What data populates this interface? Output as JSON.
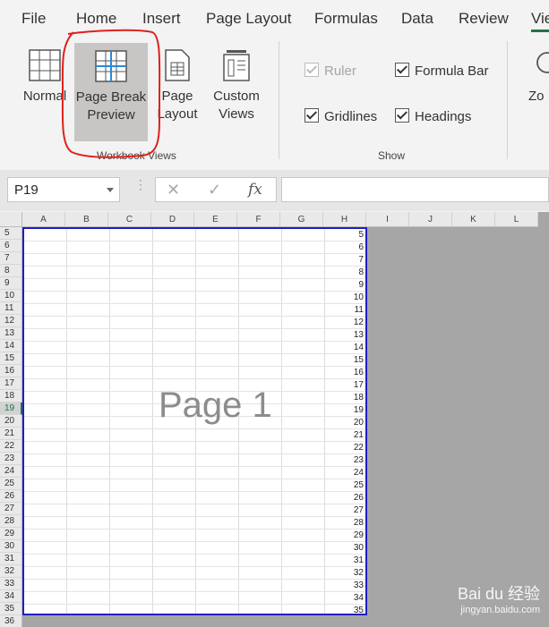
{
  "tabs": [
    "File",
    "Home",
    "Insert",
    "Page Layout",
    "Formulas",
    "Data",
    "Review",
    "Vie"
  ],
  "workbook_views": {
    "group_label": "Workbook Views",
    "buttons": [
      {
        "label_line1": "Normal",
        "label_line2": ""
      },
      {
        "label_line1": "Page Break",
        "label_line2": "Preview"
      },
      {
        "label_line1": "Page",
        "label_line2": "Layout"
      },
      {
        "label_line1": "Custom",
        "label_line2": "Views"
      }
    ]
  },
  "show": {
    "group_label": "Show",
    "ruler": "Ruler",
    "formula_bar": "Formula Bar",
    "gridlines": "Gridlines",
    "headings": "Headings"
  },
  "zoom_partial": "Zo",
  "formula_bar": {
    "name_box": "P19",
    "cancel_glyph": "✕",
    "enter_glyph": "✓",
    "fx_glyph": "fx",
    "value": ""
  },
  "columns": [
    "A",
    "B",
    "C",
    "D",
    "E",
    "F",
    "G",
    "H",
    "I",
    "J",
    "K",
    "L"
  ],
  "rows": [
    "5",
    "6",
    "7",
    "8",
    "9",
    "10",
    "11",
    "12",
    "13",
    "14",
    "15",
    "16",
    "17",
    "18",
    "19",
    "20",
    "21",
    "22",
    "23",
    "24",
    "25",
    "26",
    "27",
    "28",
    "29",
    "30",
    "31",
    "32",
    "33",
    "34",
    "35",
    "36"
  ],
  "selected_row": "19",
  "column_h_values": [
    "5",
    "6",
    "7",
    "8",
    "9",
    "10",
    "11",
    "12",
    "13",
    "14",
    "15",
    "16",
    "17",
    "18",
    "19",
    "20",
    "21",
    "22",
    "23",
    "24",
    "25",
    "26",
    "27",
    "28",
    "29",
    "30",
    "31",
    "32",
    "33",
    "34",
    "35"
  ],
  "page_label": "Page 1",
  "watermark": {
    "line1": "Bai du 经验",
    "line2": "jingyan.baidu.com"
  },
  "colors": {
    "accent": "#217346",
    "page_break_border": "#1f1fbf",
    "highlight_annotation": "#e0201b"
  }
}
